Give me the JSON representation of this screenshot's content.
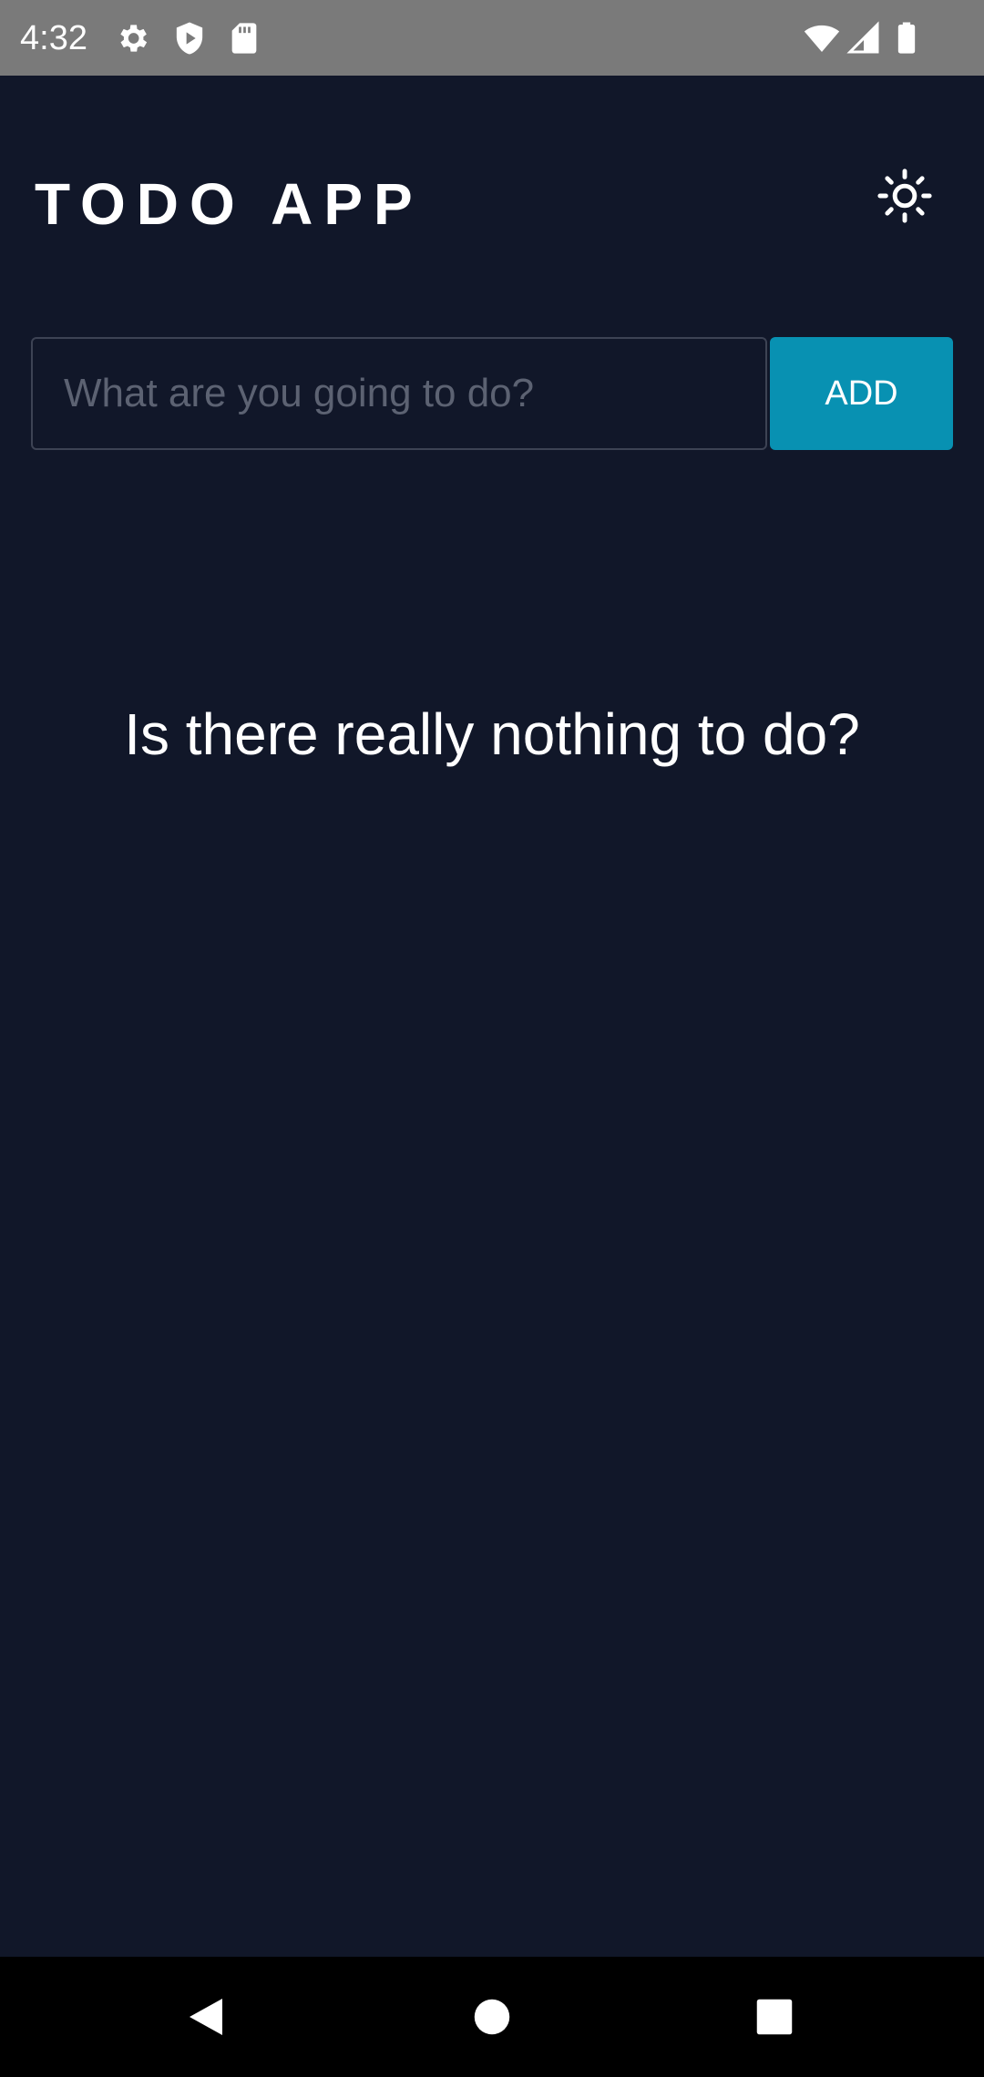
{
  "status_bar": {
    "time": "4:32",
    "left_icons": [
      "gear-icon",
      "shield-play-icon",
      "sd-card-icon"
    ],
    "right_icons": [
      "wifi-icon",
      "signal-icon",
      "battery-icon"
    ]
  },
  "header": {
    "title": "TODO APP",
    "theme_toggle_icon": "sun-icon"
  },
  "todo_form": {
    "input_value": "",
    "input_placeholder": "What are you going to do?",
    "add_label": "ADD"
  },
  "empty_state": {
    "message": "Is there really nothing to do?"
  },
  "nav_bar": {
    "buttons": [
      "back-icon",
      "home-icon",
      "recents-icon"
    ]
  },
  "colors": {
    "background": "#111729",
    "accent": "#0891b2",
    "status_bar": "#7a7a7a",
    "text": "#ffffff"
  }
}
